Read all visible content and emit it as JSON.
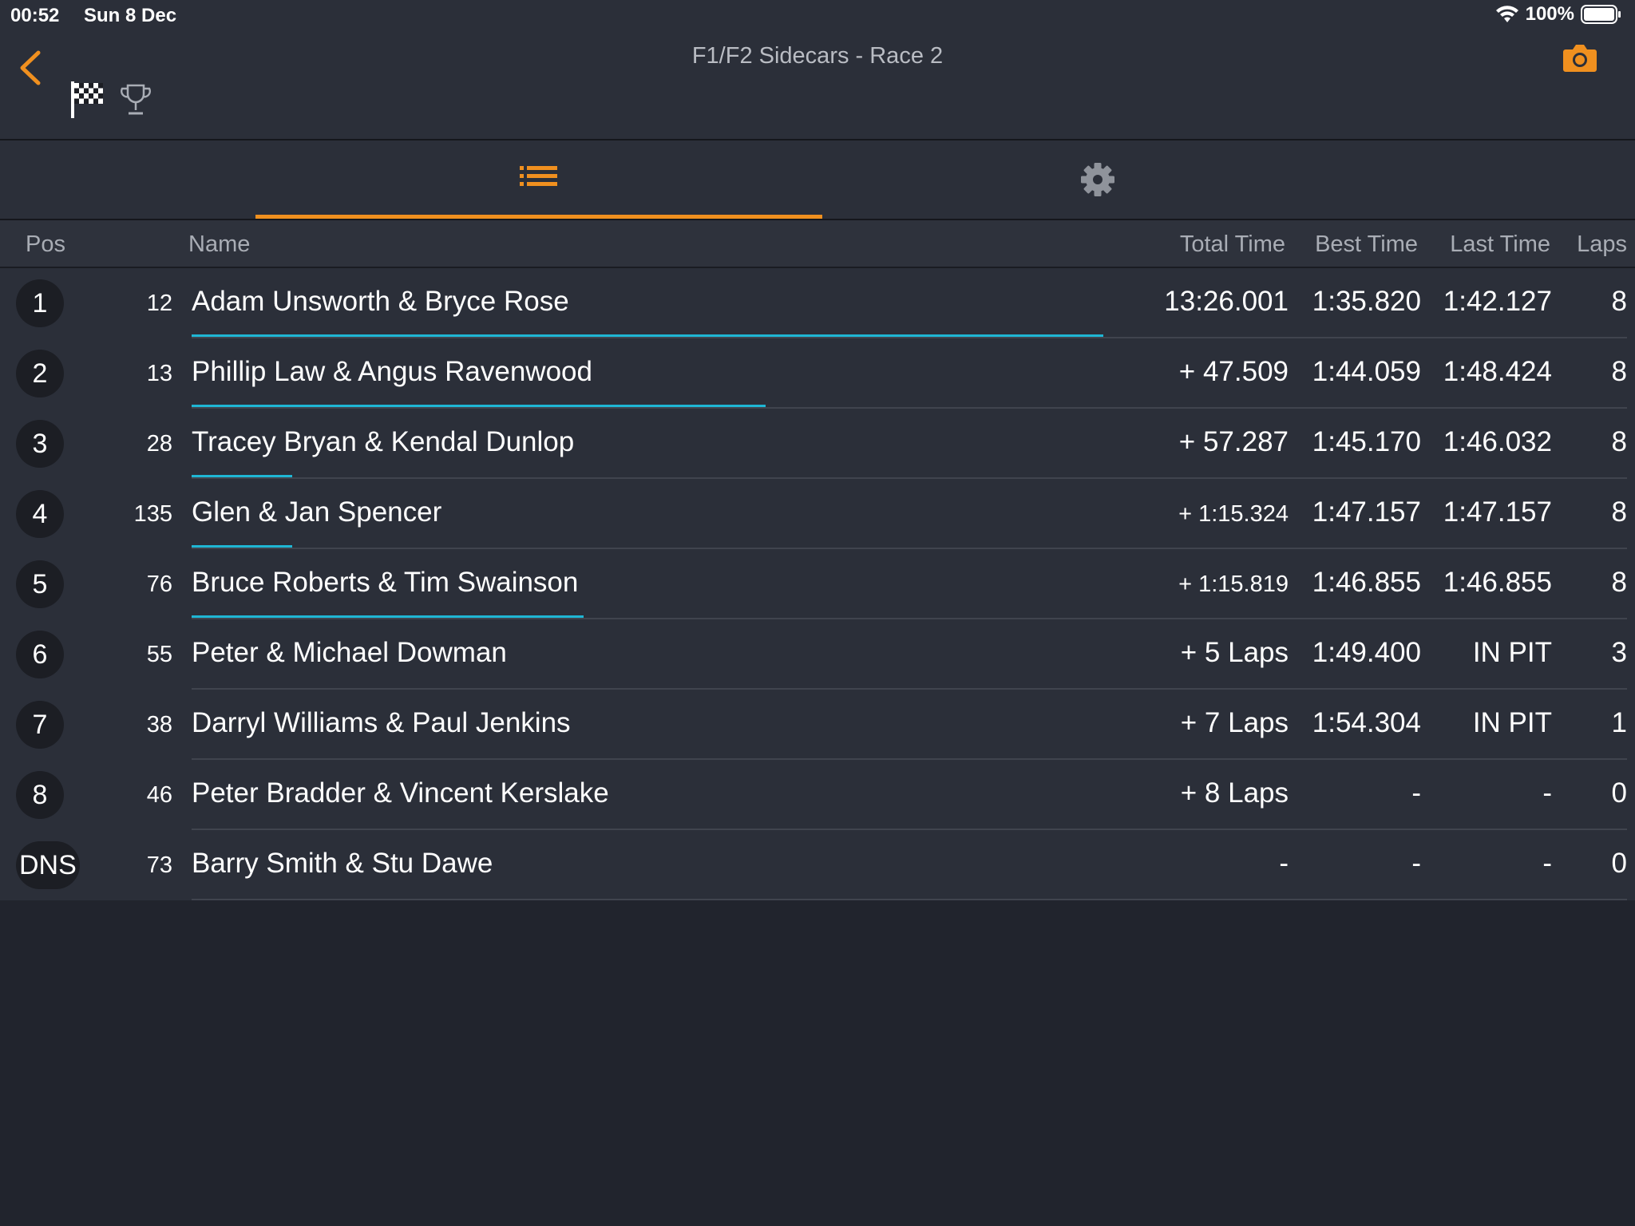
{
  "status_bar": {
    "time": "00:52",
    "date": "Sun 8 Dec",
    "battery": "100%"
  },
  "header": {
    "title": "F1/F2 Sidecars - Race 2"
  },
  "colors": {
    "accent": "#f0901f",
    "progress": "#1fb6d4",
    "background": "#21242d"
  },
  "icons": {
    "back": "chevron-left-icon",
    "flag": "checkered-flag-icon",
    "trophy": "trophy-icon",
    "camera": "camera-icon",
    "list": "list-icon",
    "settings": "gear-icon",
    "wifi": "wifi-icon",
    "battery": "battery-icon"
  },
  "columns": {
    "pos": "Pos",
    "name": "Name",
    "total": "Total Time",
    "best": "Best Time",
    "last": "Last Time",
    "laps": "Laps"
  },
  "results": [
    {
      "pos": "1",
      "number": "12",
      "name": "Adam Unsworth & Bryce Rose",
      "total": "13:26.001",
      "best": "1:35.820",
      "last": "1:42.127",
      "laps": "8",
      "progress": 1.0
    },
    {
      "pos": "2",
      "number": "13",
      "name": "Phillip Law & Angus Ravenwood",
      "total": "+ 47.509",
      "best": "1:44.059",
      "last": "1:48.424",
      "laps": "8",
      "progress": 0.63
    },
    {
      "pos": "3",
      "number": "28",
      "name": "Tracey Bryan & Kendal Dunlop",
      "total": "+ 57.287",
      "best": "1:45.170",
      "last": "1:46.032",
      "laps": "8",
      "progress": 0.11
    },
    {
      "pos": "4",
      "number": "135",
      "name": "Glen & Jan Spencer",
      "total": "+ 1:15.324",
      "best": "1:47.157",
      "last": "1:47.157",
      "laps": "8",
      "progress": 0.11
    },
    {
      "pos": "5",
      "number": "76",
      "name": "Bruce Roberts & Tim Swainson",
      "total": "+ 1:15.819",
      "best": "1:46.855",
      "last": "1:46.855",
      "laps": "8",
      "progress": 0.43
    },
    {
      "pos": "6",
      "number": "55",
      "name": "Peter & Michael Dowman",
      "total": "+ 5 Laps",
      "best": "1:49.400",
      "last": "IN PIT",
      "laps": "3",
      "progress": 0
    },
    {
      "pos": "7",
      "number": "38",
      "name": "Darryl Williams & Paul Jenkins",
      "total": "+ 7 Laps",
      "best": "1:54.304",
      "last": "IN PIT",
      "laps": "1",
      "progress": 0
    },
    {
      "pos": "8",
      "number": "46",
      "name": "Peter Bradder & Vincent Kerslake",
      "total": "+ 8 Laps",
      "best": "-",
      "last": "-",
      "laps": "0",
      "progress": 0
    },
    {
      "pos": "DNS",
      "number": "73",
      "name": "Barry Smith & Stu Dawe",
      "total": "-",
      "best": "-",
      "last": "-",
      "laps": "0",
      "progress": 0
    }
  ]
}
